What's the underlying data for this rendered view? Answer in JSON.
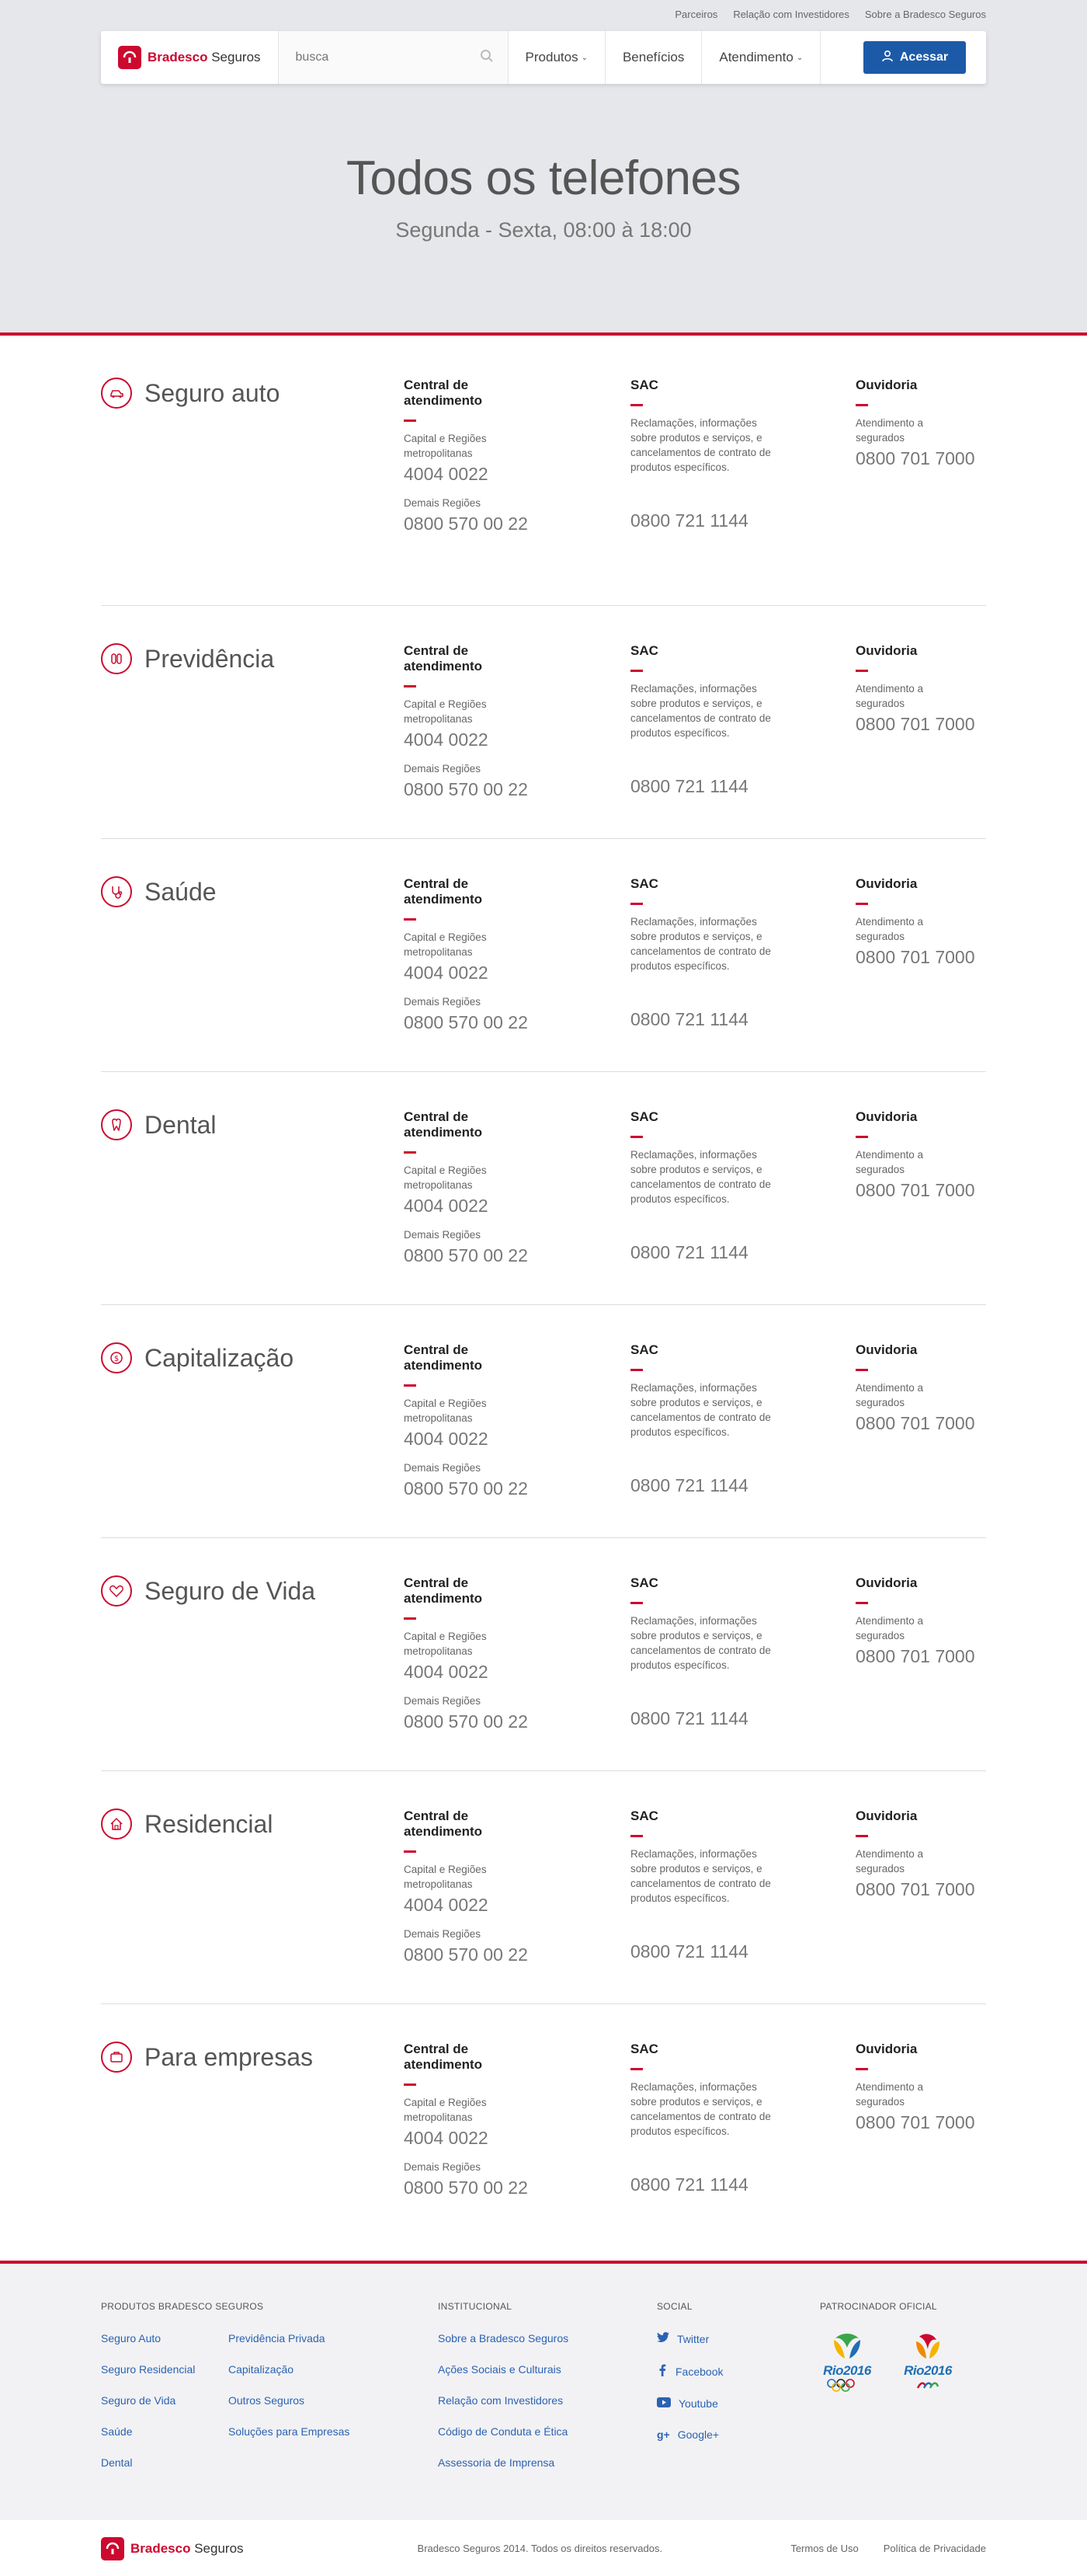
{
  "top_links": [
    "Parceiros",
    "Relação com Investidores",
    "Sobre a Bradesco Seguros"
  ],
  "brand": {
    "name_bold": "Bradesco",
    "name_rest": " Seguros"
  },
  "search": {
    "placeholder": "busca"
  },
  "menu": {
    "produtos": "Produtos",
    "beneficios": "Benefícios",
    "atendimento": "Atendimento",
    "acessar": "Acessar"
  },
  "hero": {
    "title": "Todos os telefones",
    "subtitle": "Segunda - Sexta, 08:00 à 18:00"
  },
  "labels": {
    "central": "Central de atendimento",
    "capital": "Capital e Regiões metropolitanas",
    "demais": "Demais Regiões",
    "sac": "SAC",
    "sac_desc": "Reclamações, informações sobre produtos e serviços, e cancelamentos de contrato de produtos específicos.",
    "ouvidoria": "Ouvidoria",
    "ouv_desc": "Atendimento a segurados"
  },
  "sections": [
    {
      "title": "Seguro auto",
      "icon": "car-icon",
      "capital_phone": "4004 0022",
      "demais_phone": "0800 570 00 22",
      "sac_phone": "0800 721 1144",
      "ouv_phone": "0800 701 7000"
    },
    {
      "title": "Previdência",
      "icon": "piggy-icon",
      "capital_phone": "4004 0022",
      "demais_phone": "0800 570 00 22",
      "sac_phone": "0800 721 1144",
      "ouv_phone": "0800 701 7000"
    },
    {
      "title": "Saúde",
      "icon": "stethoscope-icon",
      "capital_phone": "4004 0022",
      "demais_phone": "0800 570 00 22",
      "sac_phone": "0800 721 1144",
      "ouv_phone": "0800 701 7000"
    },
    {
      "title": "Dental",
      "icon": "tooth-icon",
      "capital_phone": "4004 0022",
      "demais_phone": "0800 570 00 22",
      "sac_phone": "0800 721 1144",
      "ouv_phone": "0800 701 7000"
    },
    {
      "title": "Capitalização",
      "icon": "coin-icon",
      "capital_phone": "4004 0022",
      "demais_phone": "0800 570 00 22",
      "sac_phone": "0800 721 1144",
      "ouv_phone": "0800 701 7000"
    },
    {
      "title": "Seguro de Vida",
      "icon": "heart-icon",
      "capital_phone": "4004 0022",
      "demais_phone": "0800 570 00 22",
      "sac_phone": "0800 721 1144",
      "ouv_phone": "0800 701 7000"
    },
    {
      "title": "Residencial",
      "icon": "house-icon",
      "capital_phone": "4004 0022",
      "demais_phone": "0800 570 00 22",
      "sac_phone": "0800 721 1144",
      "ouv_phone": "0800 701 7000"
    },
    {
      "title": "Para empresas",
      "icon": "briefcase-icon",
      "capital_phone": "4004 0022",
      "demais_phone": "0800 570 00 22",
      "sac_phone": "0800 721 1144",
      "ouv_phone": "0800 701 7000"
    }
  ],
  "footer": {
    "produtos_title": "Produtos Bradesco Seguros",
    "produtos_col1": [
      "Seguro Auto",
      "Seguro Residencial",
      "Seguro de Vida",
      "Saúde",
      "Dental"
    ],
    "produtos_col2": [
      "Previdência Privada",
      "Capitalização",
      "Outros Seguros",
      "Soluções para Empresas"
    ],
    "institucional_title": "Institucional",
    "institucional": [
      "Sobre a Bradesco Seguros",
      "Ações Sociais e Culturais",
      "Relação com Investidores",
      "Código de Conduta e Ética",
      "Assessoria de Imprensa"
    ],
    "social_title": "Social",
    "social": [
      "Twitter",
      "Facebook",
      "Youtube",
      "Google+"
    ],
    "patrocinador_title": "Patrocinador Oficial",
    "olympic_text": "Rio2016",
    "paralympic_text": "Rio2016",
    "copyright": "Bradesco Seguros 2014. Todos os direitos reservados.",
    "termos": "Termos de Uso",
    "privacidade": "Política de Privacidade"
  },
  "colors": {
    "brand_red": "#cc092f",
    "button_blue": "#1c5aa8",
    "link_blue": "#2b62b2",
    "hero_bg": "#e6e7ea"
  }
}
